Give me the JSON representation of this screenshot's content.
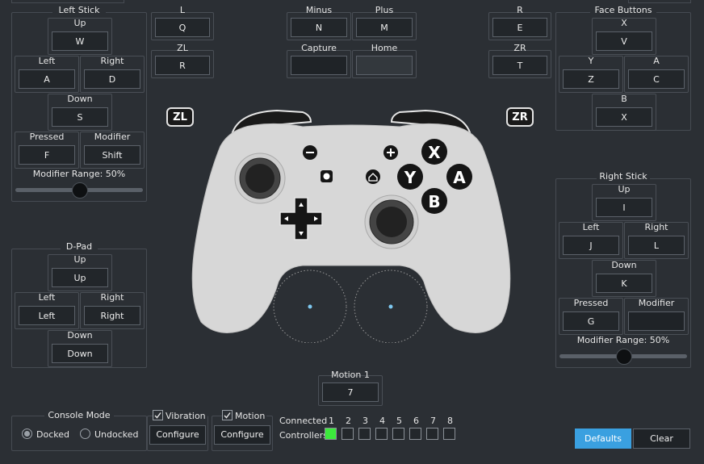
{
  "colors": {
    "background": "#2b2f34",
    "accent": "#3aa0e0",
    "connected": "#3ce93c",
    "controller_body": "#d7d7d7"
  },
  "left_stick": {
    "title": "Left Stick",
    "up_label": "Up",
    "up": "W",
    "left_label": "Left",
    "left": "A",
    "right_label": "Right",
    "right": "D",
    "down_label": "Down",
    "down": "S",
    "pressed_label": "Pressed",
    "pressed": "F",
    "modifier_label": "Modifier",
    "modifier": "Shift",
    "range_label": "Modifier Range: 50%",
    "range_value": 0.5
  },
  "shoulders_left": {
    "l_label": "L",
    "l": "Q",
    "zl_label": "ZL",
    "zl": "R"
  },
  "center_buttons": {
    "minus_label": "Minus",
    "minus": "N",
    "plus_label": "Plus",
    "plus": "M",
    "capture_label": "Capture",
    "capture": "",
    "home_label": "Home",
    "home": ""
  },
  "shoulders_right": {
    "r_label": "R",
    "r": "E",
    "zr_label": "ZR",
    "zr": "T"
  },
  "face_buttons": {
    "title": "Face Buttons",
    "x_label": "X",
    "x": "V",
    "y_label": "Y",
    "y": "Z",
    "a_label": "A",
    "a": "C",
    "b_label": "B",
    "b": "X"
  },
  "dpad": {
    "title": "D-Pad",
    "up_label": "Up",
    "up": "Up",
    "left_label": "Left",
    "left": "Left",
    "right_label": "Right",
    "right": "Right",
    "down_label": "Down",
    "down": "Down"
  },
  "right_stick": {
    "title": "Right Stick",
    "up_label": "Up",
    "up": "I",
    "left_label": "Left",
    "left": "J",
    "right_label": "Right",
    "right": "L",
    "down_label": "Down",
    "down": "K",
    "pressed_label": "Pressed",
    "pressed": "G",
    "modifier_label": "Modifier",
    "modifier": "",
    "range_label": "Modifier Range: 50%",
    "range_value": 0.5
  },
  "controller_image": {
    "zl": "ZL",
    "zr": "ZR",
    "x": "X",
    "y": "Y",
    "a": "A",
    "b": "B",
    "minus": "−",
    "plus": "+"
  },
  "motion": {
    "label": "Motion 1",
    "value": "7"
  },
  "console_mode": {
    "title": "Console Mode",
    "docked": "Docked",
    "undocked": "Undocked",
    "selected": "Docked"
  },
  "vibration": {
    "label": "Vibration",
    "checked": true,
    "configure": "Configure"
  },
  "motion_toggle": {
    "label": "Motion",
    "checked": true,
    "configure": "Configure"
  },
  "connected": {
    "line1": "Connected",
    "line2": "Controllers",
    "numbers": [
      "1",
      "2",
      "3",
      "4",
      "5",
      "6",
      "7",
      "8"
    ],
    "states": [
      true,
      false,
      false,
      false,
      false,
      false,
      false,
      false
    ]
  },
  "footer": {
    "defaults": "Defaults",
    "clear": "Clear"
  }
}
